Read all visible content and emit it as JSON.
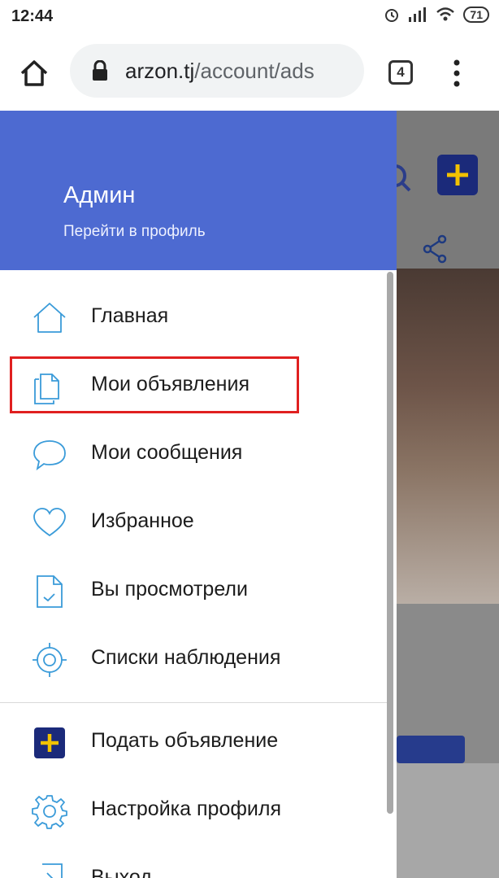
{
  "status_bar": {
    "time": "12:44",
    "battery": "71"
  },
  "browser": {
    "url_host": "arzon.tj",
    "url_path": "/account/ads",
    "tab_count": "4"
  },
  "drawer": {
    "user_name": "Админ",
    "profile_link": "Перейти в профиль",
    "items": [
      {
        "label": "Главная",
        "icon": "home-icon"
      },
      {
        "label": "Мои объявления",
        "icon": "documents-icon"
      },
      {
        "label": "Мои сообщения",
        "icon": "chat-bubble-icon"
      },
      {
        "label": "Избранное",
        "icon": "heart-icon"
      },
      {
        "label": "Вы просмотрели",
        "icon": "viewed-document-icon"
      },
      {
        "label": "Списки наблюдения",
        "icon": "target-icon"
      },
      {
        "label": "Подать объявление",
        "icon": "add-plus-icon"
      },
      {
        "label": "Настройка профиля",
        "icon": "gear-icon"
      },
      {
        "label": "Выход",
        "icon": "logout-icon"
      }
    ]
  },
  "colors": {
    "header": "#4d6ad1",
    "icon": "#3a9bd9",
    "highlight": "#e02020",
    "add_button": "#1b2a7a",
    "plus": "#f2c200"
  }
}
